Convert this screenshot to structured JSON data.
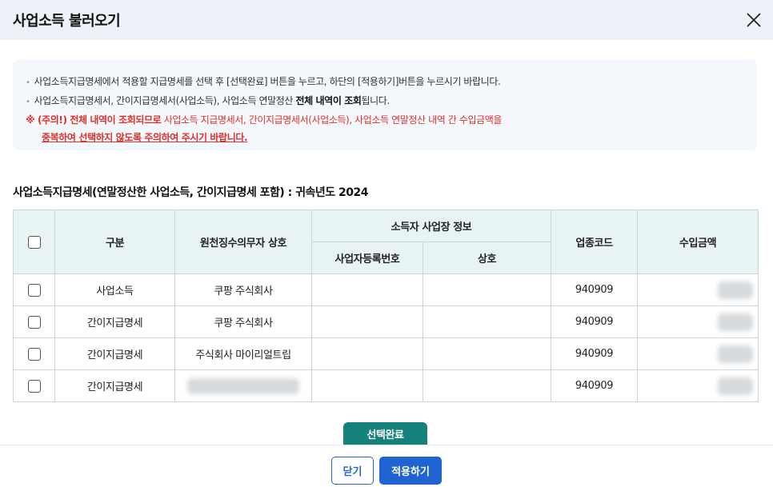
{
  "dialog": {
    "title": "사업소득 불러오기",
    "close_icon": "close-icon"
  },
  "notice": {
    "line1": "사업소득지급명세에서 적용할 지급명세를 선택 후 [선택완료] 버튼을 누르고, 하단의 [적용하기]버튼을 누르시기 바랍니다.",
    "line2_a": "사업소득지급명세서, 간이지급명세서(사업소득), 사업소득 연말정산 ",
    "line2_b": "전체 내역이 조회",
    "line2_c": "됩니다.",
    "warn_prefix": "※ (주의!) 전체 내역이 조회되므로",
    "warn_rest": " 사업소득 지급명세서, 간이지급명세서(사업소득), 사업소득 연말정산 내역 간 수입금액을",
    "warn_line2": "중복하여 선택하지 않도록 주의하여 주시기 바랍니다."
  },
  "section_title": "사업소득지급명세(연말정산한 사업소득, 간이지급명세 포함) : 귀속년도 2024",
  "table": {
    "headers": {
      "type": "구분",
      "withholder": "원천징수의무자 상호",
      "income_place": "소득자 사업장 정보",
      "biz_reg_no": "사업자등록번호",
      "trade_name": "상호",
      "industry_code": "업종코드",
      "income_amount": "수입금액"
    },
    "rows": [
      {
        "type": "사업소득",
        "withholder": "쿠팡 주식회사",
        "biz_reg_no": "",
        "trade_name": "",
        "industry_code": "940909"
      },
      {
        "type": "간이지급명세",
        "withholder": "쿠팡 주식회사",
        "biz_reg_no": "",
        "trade_name": "",
        "industry_code": "940909"
      },
      {
        "type": "간이지급명세",
        "withholder": "주식회사 마이리얼트립",
        "biz_reg_no": "",
        "trade_name": "",
        "industry_code": "940909"
      },
      {
        "type": "간이지급명세",
        "withholder": "",
        "biz_reg_no": "",
        "trade_name": "",
        "industry_code": "940909"
      }
    ]
  },
  "buttons": {
    "select_done": "선택완료",
    "close": "닫기",
    "apply": "적용하기"
  },
  "colors": {
    "header_bg": "#eef2f8",
    "table_header_bg": "#e8f3f3",
    "select_button": "#16827c",
    "apply_button": "#1f63d3",
    "warning": "#e0302a"
  }
}
